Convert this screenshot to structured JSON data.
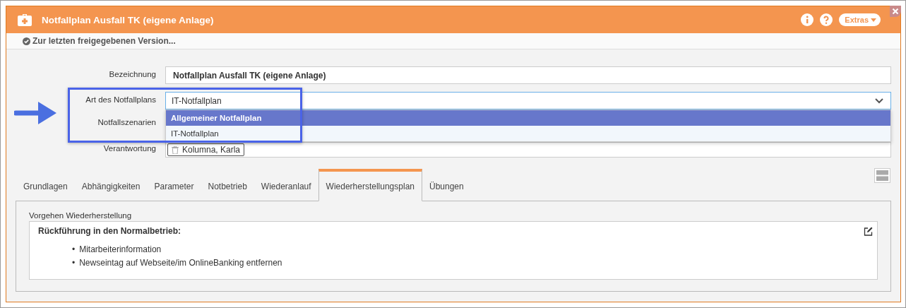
{
  "window": {
    "title": "Notfallplan Ausfall TK (eigene Anlage)",
    "extras_button": "Extras"
  },
  "toolbar": {
    "link": "Zur letzten freigegebenen Version..."
  },
  "form": {
    "fields": [
      {
        "kind": "text",
        "label": "Bezeichnung",
        "value": "Notfallplan Ausfall TK (eigene Anlage)"
      },
      {
        "kind": "select",
        "label": "Art des Notfallplans",
        "value": "IT-Notfallplan",
        "expanded": true,
        "options": [
          {
            "label": "Allgemeiner Notfallplan",
            "highlighted": true
          },
          {
            "label": "IT-Notfallplan",
            "highlighted": false
          }
        ]
      },
      {
        "kind": "hidden",
        "label": "Notfallszenarien"
      },
      {
        "kind": "chips",
        "label": "Verantwortung",
        "chips": [
          "Kolumna, Karla"
        ]
      }
    ]
  },
  "tabs": [
    {
      "label": "Grundlagen",
      "selected": false
    },
    {
      "label": "Abhängigkeiten",
      "selected": false
    },
    {
      "label": "Parameter",
      "selected": false
    },
    {
      "label": "Notbetrieb",
      "selected": false
    },
    {
      "label": "Wiederanlauf",
      "selected": false
    },
    {
      "label": "Wiederherstellungsplan",
      "selected": true
    },
    {
      "label": "Übungen",
      "selected": false
    }
  ],
  "section": {
    "label": "Vorgehen Wiederherstellung",
    "heading": "Rückführung in den Normalbetrieb:",
    "bullets": [
      {
        "marker": "•",
        "text": "Mitarbeiterinformation"
      },
      {
        "marker": "•",
        "text": "Newseintag auf Webseite/im OnlineBanking entfernen"
      }
    ]
  }
}
